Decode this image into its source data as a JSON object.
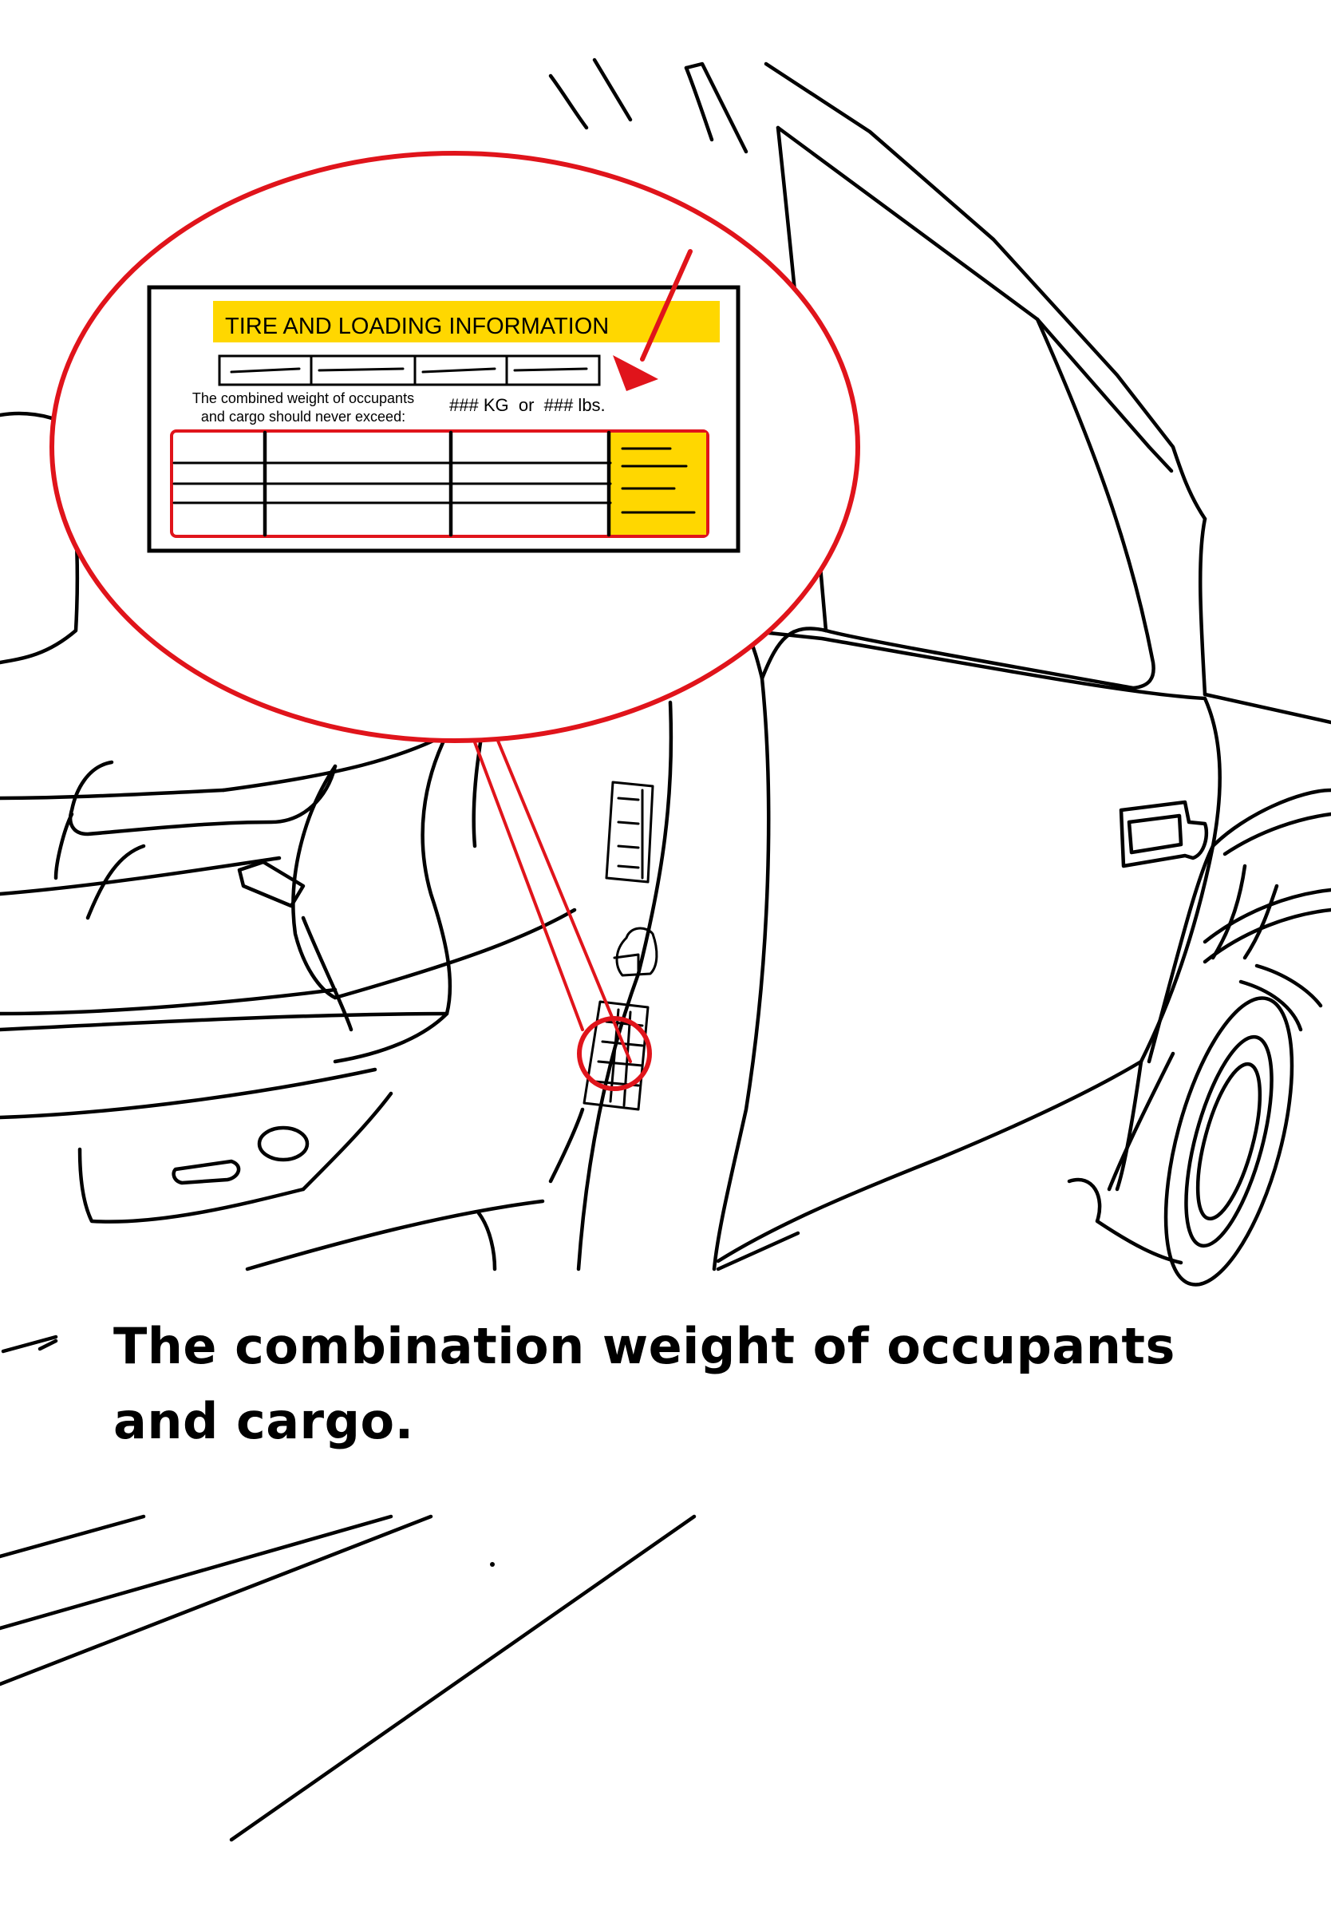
{
  "label": {
    "title": "TIRE AND LOADING INFORMATION",
    "limit_text_line1": "The combined weight of occupants",
    "limit_text_line2": "and cargo should never exceed:",
    "limit_value": "### KG  or  ### lbs."
  },
  "caption": "The combination weight of occupants and cargo.",
  "colors": {
    "highlight_red": "#e0141b",
    "label_yellow": "#ffd700",
    "ink": "#000000"
  }
}
